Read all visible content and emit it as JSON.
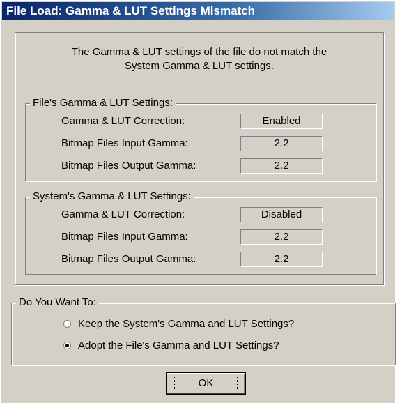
{
  "window": {
    "title": "File Load: Gamma & LUT Settings Mismatch"
  },
  "message": {
    "line1": "The Gamma & LUT settings of the file do not match the",
    "line2": "System Gamma & LUT settings."
  },
  "file_settings": {
    "legend": "File's Gamma & LUT Settings:",
    "rows": [
      {
        "label": "Gamma & LUT Correction:",
        "value": "Enabled"
      },
      {
        "label": "Bitmap Files Input Gamma:",
        "value": "2.2"
      },
      {
        "label": "Bitmap Files Output Gamma:",
        "value": "2.2"
      }
    ]
  },
  "system_settings": {
    "legend": "System's Gamma & LUT Settings:",
    "rows": [
      {
        "label": "Gamma & LUT Correction:",
        "value": "Disabled"
      },
      {
        "label": "Bitmap Files Input Gamma:",
        "value": "2.2"
      },
      {
        "label": "Bitmap Files Output Gamma:",
        "value": "2.2"
      }
    ]
  },
  "choice": {
    "legend": "Do You Want To:",
    "options": [
      {
        "label": "Keep the System's Gamma and LUT Settings?",
        "selected": false
      },
      {
        "label": "Adopt the File's Gamma and LUT Settings?",
        "selected": true
      }
    ]
  },
  "buttons": {
    "ok_label": "OK"
  }
}
